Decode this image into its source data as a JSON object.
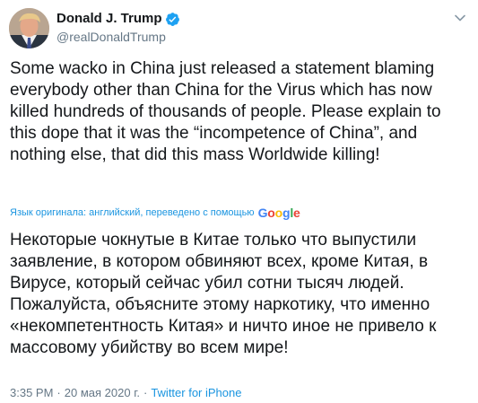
{
  "author": {
    "display_name": "Donald J. Trump",
    "handle": "@realDonaldTrump",
    "verified": true,
    "verified_badge_color": "#1da1f2"
  },
  "tweet": {
    "text": "Some wacko in China just released a statement blaming everybody other than China for the Virus which has now killed hundreds of thousands of people. Please explain to this dope that it was the “incompetence of China”, and nothing else, that did this mass Worldwide killing!"
  },
  "translation": {
    "label": "Язык оригинала: английский, переведено с помощью",
    "provider": "Google",
    "text": "Некоторые чокнутые в Китае только что выпустили заявление, в котором обвиняют всех, кроме Китая, в Вирусе, который сейчас убил сотни тысяч людей. Пожалуйста, объясните этому наркотику, что именно «некомпетентность Китая» и ничто иное не привело к массовому убийству во всем мире!"
  },
  "meta": {
    "time": "3:35 PM",
    "separator": "·",
    "date": "20 мая 2020 г.",
    "source": "Twitter for iPhone"
  },
  "colors": {
    "text": "#14171a",
    "secondary": "#657786",
    "link": "#1b95e0"
  },
  "icons": {
    "verified": "verified-badge-icon",
    "caret": "chevron-down-icon"
  }
}
